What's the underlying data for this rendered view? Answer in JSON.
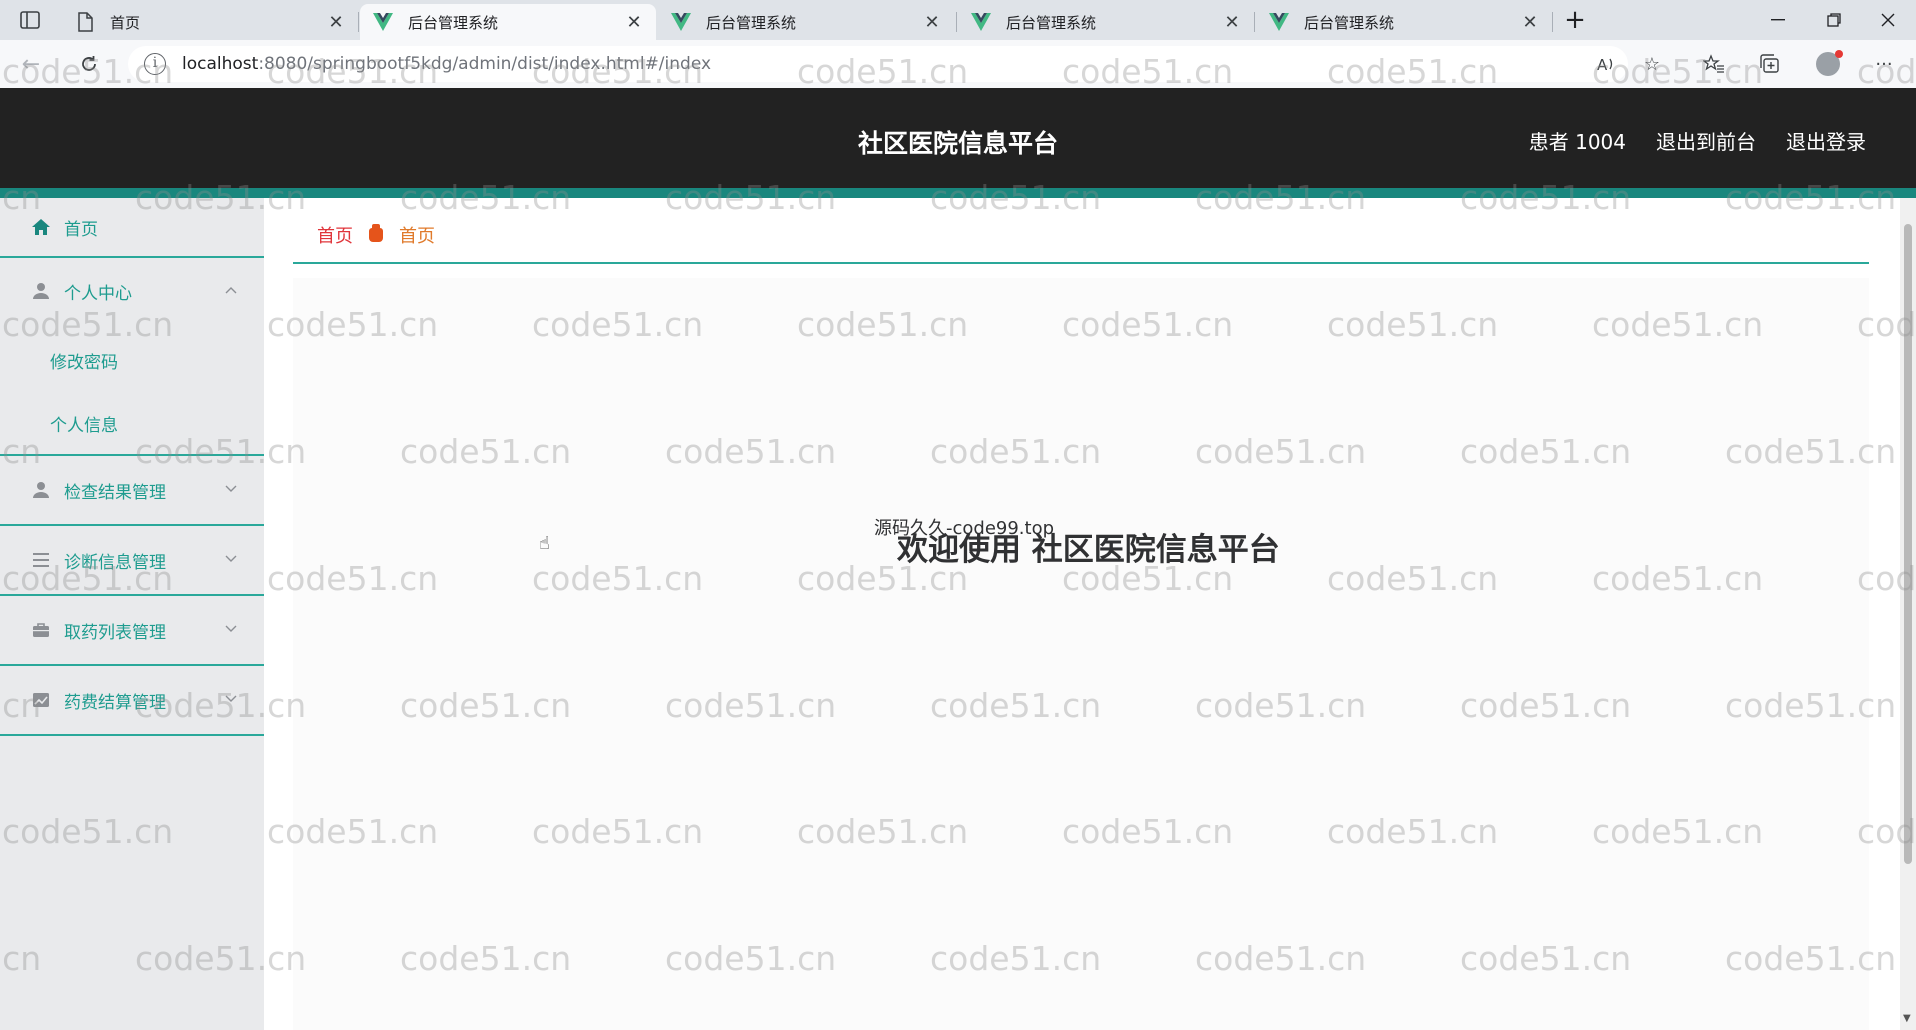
{
  "browser": {
    "tabs": [
      {
        "title": "首页",
        "icon": "page-icon",
        "active": false
      },
      {
        "title": "后台管理系统",
        "icon": "vue-icon",
        "active": true
      },
      {
        "title": "后台管理系统",
        "icon": "vue-icon",
        "active": false
      },
      {
        "title": "后台管理系统",
        "icon": "vue-icon",
        "active": false
      },
      {
        "title": "后台管理系统",
        "icon": "vue-icon",
        "active": false
      }
    ],
    "url_host": "localhost",
    "url_path": ":8080/springbootf5kdg/admin/dist/index.html#/index"
  },
  "header": {
    "title": "社区医院信息平台",
    "user_label": "患者 1004",
    "to_front_label": "退出到前台",
    "logout_label": "退出登录"
  },
  "sidebar": {
    "home": "首页",
    "personal_center": {
      "label": "个人中心",
      "children": [
        "修改密码",
        "个人信息"
      ]
    },
    "exam_results": "检查结果管理",
    "diagnosis_info": "诊断信息管理",
    "pickup_list": "取药列表管理",
    "fee_settlement": "药费结算管理"
  },
  "breadcrumb": {
    "home": "首页",
    "current": "首页"
  },
  "main": {
    "welcome": "欢迎使用 社区医院信息平台",
    "overlay_note": "源码久久-code99.top"
  },
  "watermark": "code51.cn",
  "colors": {
    "header_bg": "#222222",
    "accent_teal": "#19877e",
    "menu_text": "#1e9c8f",
    "breadcrumb_home": "#e0353b",
    "breadcrumb_current": "#e07a2b"
  }
}
